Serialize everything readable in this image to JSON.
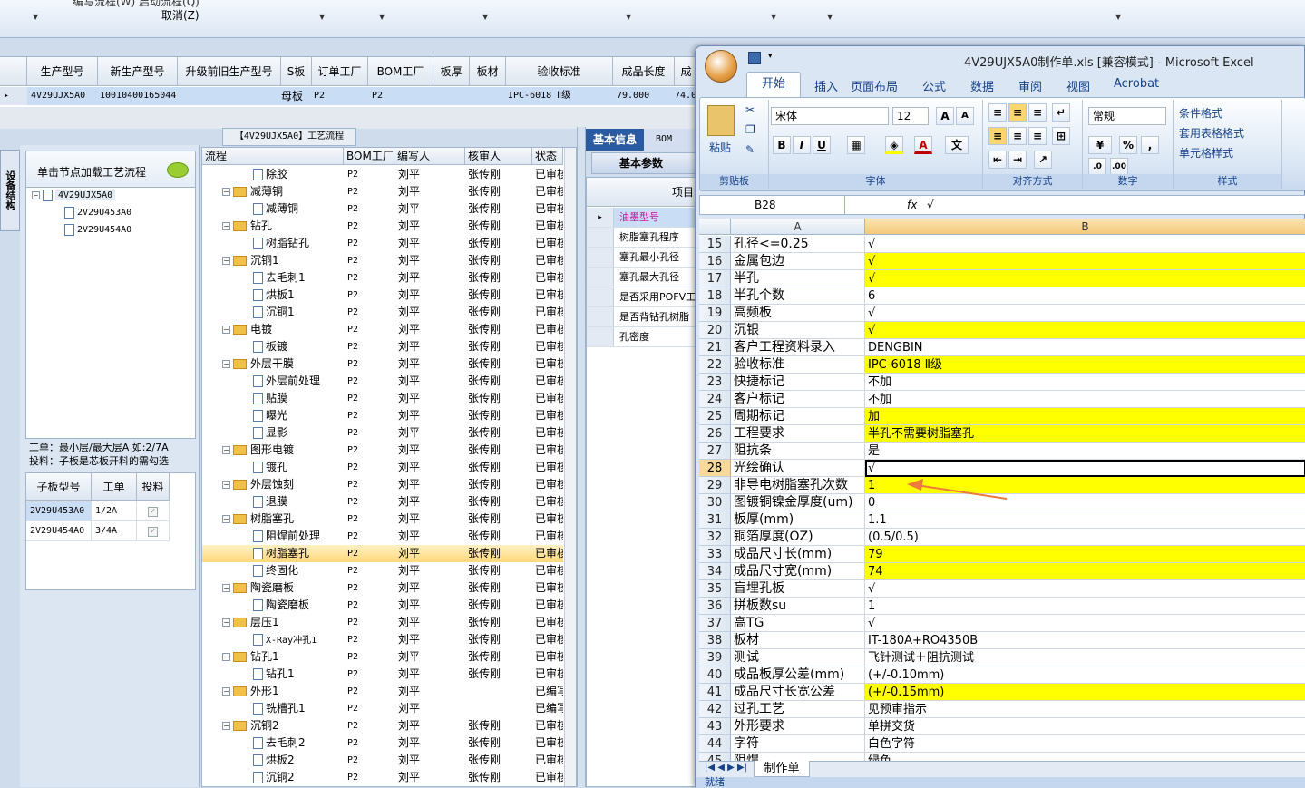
{
  "toolbar": {
    "menu_partial": "编写流程(W)   启动流程(Q)",
    "cancel": "取消(Z)"
  },
  "main_grid": {
    "headers": [
      "生产型号",
      "新生产型号",
      "升级前旧生产型号",
      "S板",
      "订单工厂",
      "BOM工厂",
      "板厚",
      "板材",
      "验收标准",
      "成品长度",
      "成"
    ],
    "row": [
      "4V29UJX5A0",
      "10010400165044",
      "",
      "母板",
      "P2",
      "P2",
      "",
      "",
      "IPC-6018 Ⅱ级",
      "79.000",
      "74.0"
    ]
  },
  "left_panel": {
    "vertical_tab": "设备结构",
    "load_prompt": "单击节点加载工艺流程",
    "tree": [
      "4V29UJX5A0",
      "2V29U453A0",
      "2V29U454A0"
    ],
    "info_line1": "工单：最小层/最大层A 如:2/7A",
    "info_line2": "投料：子板是芯板开料的需勾选",
    "sub_headers": [
      "子板型号",
      "工单",
      "投料"
    ],
    "sub_rows": [
      {
        "model": "2V29U453A0",
        "order": "1/2A",
        "feed": true
      },
      {
        "model": "2V29U454A0",
        "order": "3/4A",
        "feed": true
      }
    ]
  },
  "process": {
    "title": "【4V29UJX5A0】工艺流程",
    "headers": [
      "流程",
      "BOM工厂",
      "编写人",
      "核审人",
      "状态"
    ],
    "rows": [
      {
        "lvl": 2,
        "type": "doc",
        "name": "除胶",
        "bom": "P2",
        "writer": "刘平",
        "reviewer": "张传刚",
        "status": "已审核"
      },
      {
        "lvl": 1,
        "type": "folder",
        "name": "减薄铜",
        "bom": "P2",
        "writer": "刘平",
        "reviewer": "张传刚",
        "status": "已审核"
      },
      {
        "lvl": 2,
        "type": "doc",
        "name": "减薄铜",
        "bom": "P2",
        "writer": "刘平",
        "reviewer": "张传刚",
        "status": "已审核"
      },
      {
        "lvl": 1,
        "type": "folder",
        "name": "钻孔",
        "bom": "P2",
        "writer": "刘平",
        "reviewer": "张传刚",
        "status": "已审核"
      },
      {
        "lvl": 2,
        "type": "doc",
        "name": "树脂钻孔",
        "bom": "P2",
        "writer": "刘平",
        "reviewer": "张传刚",
        "status": "已审核"
      },
      {
        "lvl": 1,
        "type": "folder",
        "name": "沉铜1",
        "bom": "P2",
        "writer": "刘平",
        "reviewer": "张传刚",
        "status": "已审核"
      },
      {
        "lvl": 2,
        "type": "doc",
        "name": "去毛刺1",
        "bom": "P2",
        "writer": "刘平",
        "reviewer": "张传刚",
        "status": "已审核"
      },
      {
        "lvl": 2,
        "type": "doc",
        "name": "烘板1",
        "bom": "P2",
        "writer": "刘平",
        "reviewer": "张传刚",
        "status": "已审核"
      },
      {
        "lvl": 2,
        "type": "doc",
        "name": "沉铜1",
        "bom": "P2",
        "writer": "刘平",
        "reviewer": "张传刚",
        "status": "已审核"
      },
      {
        "lvl": 1,
        "type": "folder",
        "name": "电镀",
        "bom": "P2",
        "writer": "刘平",
        "reviewer": "张传刚",
        "status": "已审核"
      },
      {
        "lvl": 2,
        "type": "doc",
        "name": "板镀",
        "bom": "P2",
        "writer": "刘平",
        "reviewer": "张传刚",
        "status": "已审核"
      },
      {
        "lvl": 1,
        "type": "folder",
        "name": "外层干膜",
        "bom": "P2",
        "writer": "刘平",
        "reviewer": "张传刚",
        "status": "已审核"
      },
      {
        "lvl": 2,
        "type": "doc",
        "name": "外层前处理",
        "bom": "P2",
        "writer": "刘平",
        "reviewer": "张传刚",
        "status": "已审核"
      },
      {
        "lvl": 2,
        "type": "doc",
        "name": "贴膜",
        "bom": "P2",
        "writer": "刘平",
        "reviewer": "张传刚",
        "status": "已审核"
      },
      {
        "lvl": 2,
        "type": "doc",
        "name": "曝光",
        "bom": "P2",
        "writer": "刘平",
        "reviewer": "张传刚",
        "status": "已审核"
      },
      {
        "lvl": 2,
        "type": "doc",
        "name": "显影",
        "bom": "P2",
        "writer": "刘平",
        "reviewer": "张传刚",
        "status": "已审核"
      },
      {
        "lvl": 1,
        "type": "folder",
        "name": "图形电镀",
        "bom": "P2",
        "writer": "刘平",
        "reviewer": "张传刚",
        "status": "已审核"
      },
      {
        "lvl": 2,
        "type": "doc",
        "name": "镀孔",
        "bom": "P2",
        "writer": "刘平",
        "reviewer": "张传刚",
        "status": "已审核"
      },
      {
        "lvl": 1,
        "type": "folder",
        "name": "外层蚀刻",
        "bom": "P2",
        "writer": "刘平",
        "reviewer": "张传刚",
        "status": "已审核"
      },
      {
        "lvl": 2,
        "type": "doc",
        "name": "退膜",
        "bom": "P2",
        "writer": "刘平",
        "reviewer": "张传刚",
        "status": "已审核"
      },
      {
        "lvl": 1,
        "type": "folder",
        "name": "树脂塞孔",
        "bom": "P2",
        "writer": "刘平",
        "reviewer": "张传刚",
        "status": "已审核"
      },
      {
        "lvl": 2,
        "type": "doc",
        "name": "阻焊前处理",
        "bom": "P2",
        "writer": "刘平",
        "reviewer": "张传刚",
        "status": "已审核"
      },
      {
        "lvl": 2,
        "type": "doc",
        "name": "树脂塞孔",
        "bom": "P2",
        "writer": "刘平",
        "reviewer": "张传刚",
        "status": "已审核",
        "selected": true
      },
      {
        "lvl": 2,
        "type": "doc",
        "name": "终固化",
        "bom": "P2",
        "writer": "刘平",
        "reviewer": "张传刚",
        "status": "已审核"
      },
      {
        "lvl": 1,
        "type": "folder",
        "name": "陶瓷磨板",
        "bom": "P2",
        "writer": "刘平",
        "reviewer": "张传刚",
        "status": "已审核"
      },
      {
        "lvl": 2,
        "type": "doc",
        "name": "陶瓷磨板",
        "bom": "P2",
        "writer": "刘平",
        "reviewer": "张传刚",
        "status": "已审核"
      },
      {
        "lvl": 1,
        "type": "folder",
        "name": "层压1",
        "bom": "P2",
        "writer": "刘平",
        "reviewer": "张传刚",
        "status": "已审核"
      },
      {
        "lvl": 2,
        "type": "doc",
        "name": "X-Ray冲孔1",
        "bom": "P2",
        "writer": "刘平",
        "reviewer": "张传刚",
        "status": "已审核"
      },
      {
        "lvl": 1,
        "type": "folder",
        "name": "钻孔1",
        "bom": "P2",
        "writer": "刘平",
        "reviewer": "张传刚",
        "status": "已审核"
      },
      {
        "lvl": 2,
        "type": "doc",
        "name": "钻孔1",
        "bom": "P2",
        "writer": "刘平",
        "reviewer": "张传刚",
        "status": "已审核"
      },
      {
        "lvl": 1,
        "type": "folder",
        "name": "外形1",
        "bom": "P2",
        "writer": "刘平",
        "reviewer": "",
        "status": "已编写"
      },
      {
        "lvl": 2,
        "type": "doc",
        "name": "铣槽孔1",
        "bom": "P2",
        "writer": "刘平",
        "reviewer": "",
        "status": "已编写"
      },
      {
        "lvl": 1,
        "type": "folder",
        "name": "沉铜2",
        "bom": "P2",
        "writer": "刘平",
        "reviewer": "张传刚",
        "status": "已审核"
      },
      {
        "lvl": 2,
        "type": "doc",
        "name": "去毛刺2",
        "bom": "P2",
        "writer": "刘平",
        "reviewer": "张传刚",
        "status": "已审核"
      },
      {
        "lvl": 2,
        "type": "doc",
        "name": "烘板2",
        "bom": "P2",
        "writer": "刘平",
        "reviewer": "张传刚",
        "status": "已审核"
      },
      {
        "lvl": 2,
        "type": "doc",
        "name": "沉铜2",
        "bom": "P2",
        "writer": "刘平",
        "reviewer": "张传刚",
        "status": "已审核"
      }
    ]
  },
  "basic_info": {
    "tab_basic": "基本信息",
    "tab_bom": "BOM",
    "subtab": "基本参数",
    "col_header": "项目",
    "rows": [
      "油墨型号",
      "树脂塞孔程序",
      "塞孔最小孔径",
      "塞孔最大孔径",
      "是否采用POFV工",
      "是否背钻孔树脂",
      "孔密度"
    ]
  },
  "excel": {
    "title": "4V29UJX5A0制作单.xls  [兼容模式] - Microsoft Excel",
    "tabs": [
      "开始",
      "插入",
      "页面布局",
      "公式",
      "数据",
      "审阅",
      "视图",
      "Acrobat"
    ],
    "clipboard": {
      "paste": "粘贴",
      "label": "剪贴板"
    },
    "font": {
      "name": "宋体",
      "size": "12",
      "label": "字体"
    },
    "align_label": "对齐方式",
    "number": {
      "format": "常规",
      "label": "数字"
    },
    "styles": {
      "cond": "条件格式",
      "table": "套用表格格式",
      "cell": "单元格样式",
      "label": "样式"
    },
    "namebox": "B28",
    "fx": "fx",
    "formula": "√",
    "col_a": "A",
    "col_b": "B",
    "rows": [
      {
        "n": "15",
        "a": "孔径<=0.25",
        "b": "√",
        "y": false
      },
      {
        "n": "16",
        "a": "金属包边",
        "b": "√",
        "y": true
      },
      {
        "n": "17",
        "a": "半孔",
        "b": "√",
        "y": true
      },
      {
        "n": "18",
        "a": "半孔个数",
        "b": "6",
        "y": false
      },
      {
        "n": "19",
        "a": "高频板",
        "b": "√",
        "y": false
      },
      {
        "n": "20",
        "a": "沉银",
        "b": "√",
        "y": true
      },
      {
        "n": "21",
        "a": "客户工程资料录入",
        "b": "DENGBIN",
        "y": false
      },
      {
        "n": "22",
        "a": "验收标准",
        "b": "IPC-6018 Ⅱ级",
        "y": true
      },
      {
        "n": "23",
        "a": "快捷标记",
        "b": "不加",
        "y": false
      },
      {
        "n": "24",
        "a": "客户标记",
        "b": "不加",
        "y": false
      },
      {
        "n": "25",
        "a": "周期标记",
        "b": "加",
        "y": true
      },
      {
        "n": "26",
        "a": "工程要求",
        "b": "半孔不需要树脂塞孔",
        "y": true
      },
      {
        "n": "27",
        "a": "阻抗条",
        "b": "是",
        "y": false
      },
      {
        "n": "28",
        "a": "光绘确认",
        "b": "√",
        "y": false,
        "active": true
      },
      {
        "n": "29",
        "a": "非导电树脂塞孔次数",
        "b": "1",
        "y": true
      },
      {
        "n": "30",
        "a": "图镀铜镍金厚度(um)",
        "b": "0",
        "y": false
      },
      {
        "n": "31",
        "a": "板厚(mm)",
        "b": "1.1",
        "y": false
      },
      {
        "n": "32",
        "a": "铜箔厚度(OZ)",
        "b": "(0.5/0.5)",
        "y": false
      },
      {
        "n": "33",
        "a": "成品尺寸长(mm)",
        "b": "79",
        "y": true
      },
      {
        "n": "34",
        "a": "成品尺寸宽(mm)",
        "b": "74",
        "y": true
      },
      {
        "n": "35",
        "a": "盲埋孔板",
        "b": "√",
        "y": false
      },
      {
        "n": "36",
        "a": "拼板数su",
        "b": "1",
        "y": false
      },
      {
        "n": "37",
        "a": "高TG",
        "b": "√",
        "y": false
      },
      {
        "n": "38",
        "a": "板材",
        "b": "IT-180A+RO4350B",
        "y": false
      },
      {
        "n": "39",
        "a": "测试",
        "b": "飞针测试＋阻抗测试",
        "y": false
      },
      {
        "n": "40",
        "a": "成品板厚公差(mm)",
        "b": "(+/-0.10mm)",
        "y": false
      },
      {
        "n": "41",
        "a": "成品尺寸长宽公差",
        "b": "(+/-0.15mm)",
        "y": true
      },
      {
        "n": "42",
        "a": "过孔工艺",
        "b": "见预审指示",
        "y": false
      },
      {
        "n": "43",
        "a": "外形要求",
        "b": "单拼交货",
        "y": false
      },
      {
        "n": "44",
        "a": "字符",
        "b": "白色字符",
        "y": false
      },
      {
        "n": "45",
        "a": "阻焊",
        "b": "绿色",
        "y": false
      }
    ],
    "sheet_tab": "制作单",
    "status": "就绪"
  },
  "annotation": {
    "color": "#f07a3c"
  }
}
